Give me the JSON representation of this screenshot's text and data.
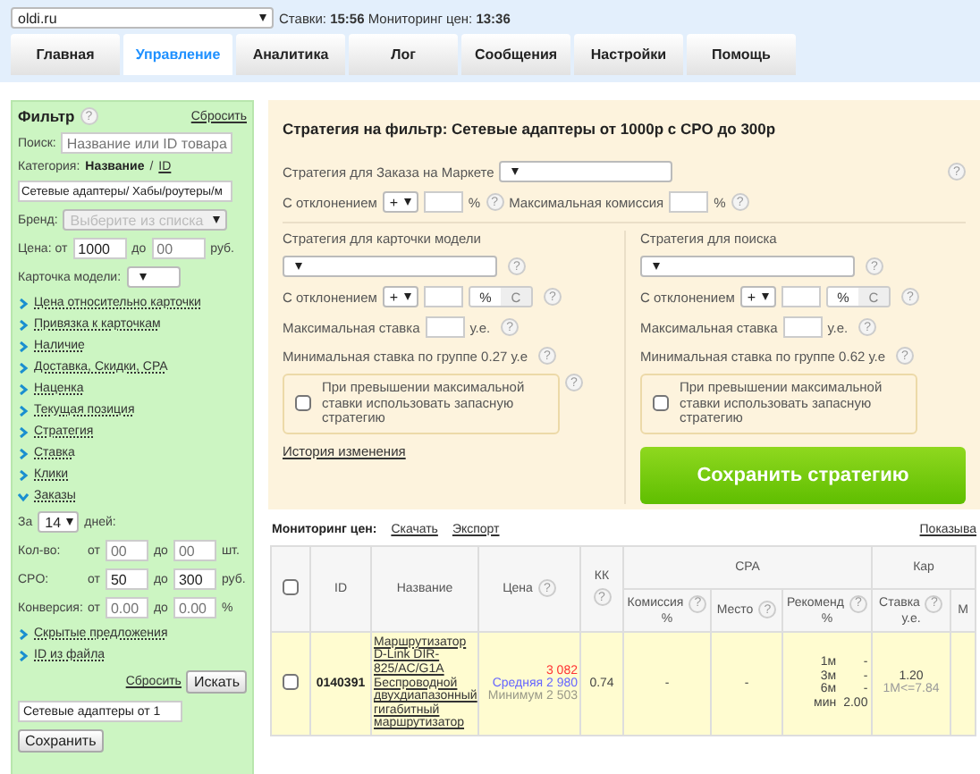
{
  "site_select": {
    "value": "oldi.ru"
  },
  "status": "Ставки: **15:56** Мониторинг цен: **13:36**",
  "tabs": [
    {
      "label": "Главная",
      "selected": false
    },
    {
      "label": "Управление",
      "selected": true
    },
    {
      "label": "Аналитика",
      "selected": false
    },
    {
      "label": "Лог",
      "selected": false
    },
    {
      "label": "Сообщения",
      "selected": false
    },
    {
      "label": "Настройки",
      "selected": false
    },
    {
      "label": "Помощь",
      "selected": false
    }
  ],
  "filter": {
    "title": "Фильтр",
    "help": "?",
    "reset": "Сбросить",
    "search": {
      "label": "Поиск:",
      "placeholder": "Название или ID товара"
    },
    "category": {
      "label": "Категория:",
      "mode_name": "Название",
      "separator": "/",
      "mode_id": "ID",
      "value": "Сетевые адаптеры/ Хабы/роутеры/м"
    },
    "brand": {
      "label": "Бренд:",
      "placeholder": "Выберите из списка",
      "disabled": true
    },
    "price": {
      "label": "Цена: от",
      "from": "1000",
      "to_label": "до",
      "to_placeholder": "00",
      "unit": "руб."
    },
    "model_card": {
      "label": "Карточка модели:"
    },
    "sections": [
      {
        "label": "Цена относительно карточки",
        "expanded": false
      },
      {
        "label": "Привязка к карточкам",
        "expanded": false
      },
      {
        "label": "Наличие",
        "expanded": false
      },
      {
        "label": "Доставка, Скидки, CPA",
        "expanded": false
      },
      {
        "label": "Наценка",
        "expanded": false
      },
      {
        "label": "Текущая позиция",
        "expanded": false
      },
      {
        "label": "Стратегия",
        "expanded": false
      },
      {
        "label": "Ставка",
        "expanded": false
      },
      {
        "label": "Клики",
        "expanded": false
      },
      {
        "label": "Заказы",
        "expanded": true
      }
    ],
    "orders": {
      "period_label": "За",
      "period": "14",
      "days_label": "дней:",
      "ranges": [
        {
          "label": "Кол-во:",
          "from_label": "от",
          "from_placeholder": "00",
          "to_label": "до",
          "to_placeholder": "00",
          "unit": "шт."
        },
        {
          "label": "CPO:",
          "from_label": "от",
          "from_value": "50",
          "to_label": "до",
          "to_value": "300",
          "unit": "руб."
        },
        {
          "label": "Конверсия:",
          "from_label": "от",
          "from_placeholder": "0.00",
          "to_label": "до",
          "to_placeholder": "0.00",
          "unit": "%"
        }
      ]
    },
    "more_sections": [
      {
        "label": "Скрытые предложения",
        "expanded": false
      },
      {
        "label": "ID из файла",
        "expanded": false
      }
    ],
    "reset_link": "Сбросить",
    "search_button": "Искать",
    "preset_name": "Сетевые адаптеры от 1",
    "save_button": "Сохранить"
  },
  "strategy": {
    "title": "Стратегия на фильтр: Сетевые адаптеры от 1000р с CPO до 300р",
    "market": {
      "label": "Стратегия для Заказа на Маркете",
      "help": "?",
      "deviation_label": "С отклонением",
      "sign": "+",
      "unit": "%",
      "deviation_help": "?",
      "commission_label": "Максимальная комиссия",
      "commission_unit": "%",
      "commission_help": "?"
    },
    "columns": [
      {
        "title": "Стратегия для карточки модели",
        "help": "?",
        "deviation_label": "С отклонением",
        "sign": "+",
        "unit_options": [
          {
            "label": "%",
            "selected": true
          },
          {
            "label": "С",
            "selected": false
          }
        ],
        "deviation_help": "?",
        "max_bid_label": "Максимальная ставка",
        "max_bid_unit": "у.е.",
        "max_bid_help": "?",
        "min_bid": "Минимальная ставка по группе 0.27 у.е",
        "min_bid_help": "?",
        "fallback": {
          "label": "При превышении максимальной ставки использовать запасную стратегию",
          "checked": false,
          "help": "?"
        },
        "footer": {
          "kind": "link",
          "label": "История изменения"
        }
      },
      {
        "title": "Стратегия для поиска",
        "help": "?",
        "deviation_label": "С отклонением",
        "sign": "+",
        "unit_options": [
          {
            "label": "%",
            "selected": true
          },
          {
            "label": "С",
            "selected": false
          }
        ],
        "deviation_help": "?",
        "max_bid_label": "Максимальная ставка",
        "max_bid_unit": "у.е.",
        "max_bid_help": "?",
        "min_bid": "Минимальная ставка по группе 0.62 у.е",
        "min_bid_help": "?",
        "fallback": {
          "label": "При превышении максимальной ставки использовать запасную стратегию",
          "checked": false
        },
        "footer": {
          "kind": "button",
          "label": "Сохранить стратегию"
        }
      }
    ]
  },
  "monitoring": {
    "title": "Мониторинг цен:",
    "links": [
      "Скачать",
      "Экспорт"
    ],
    "show_link": "Показыва"
  },
  "table": {
    "header_checked": false,
    "columns": [
      {
        "label": "ID"
      },
      {
        "label": "Название"
      },
      {
        "label": "Цена",
        "help": "?"
      },
      {
        "label": "КК",
        "help": "?"
      }
    ],
    "groups": [
      {
        "label": "CPA",
        "columns": [
          {
            "label": "Комиссия",
            "help": "?",
            "unit": "%"
          },
          {
            "label": "Место",
            "help": "?"
          },
          {
            "label": "Рекоменд",
            "help": "?",
            "unit": "%"
          }
        ]
      },
      {
        "label": "Кар",
        "columns": [
          {
            "label": "Ставка",
            "help": "?",
            "unit": "у.е."
          },
          {
            "label": "М"
          }
        ]
      }
    ],
    "rows": [
      {
        "checked": false,
        "id": "0140391",
        "name": "Маршрутизатор D-Link DIR-825/AC/G1A Беспроводной двухдиапазонный гигабитный маршрутизатор",
        "price": "3 082",
        "average": "Средняя 2 980",
        "minimum": "Минимум 2 503",
        "kk": "0.74",
        "commission": "-",
        "place": "-",
        "recommend": [
          {
            "period": "1м",
            "value": "-"
          },
          {
            "period": "3м",
            "value": "-"
          },
          {
            "period": "6м",
            "value": "-"
          },
          {
            "period": "мин",
            "value": "2.00"
          }
        ],
        "bid": "1.20",
        "bid_note": "1М<=7.84"
      }
    ]
  }
}
